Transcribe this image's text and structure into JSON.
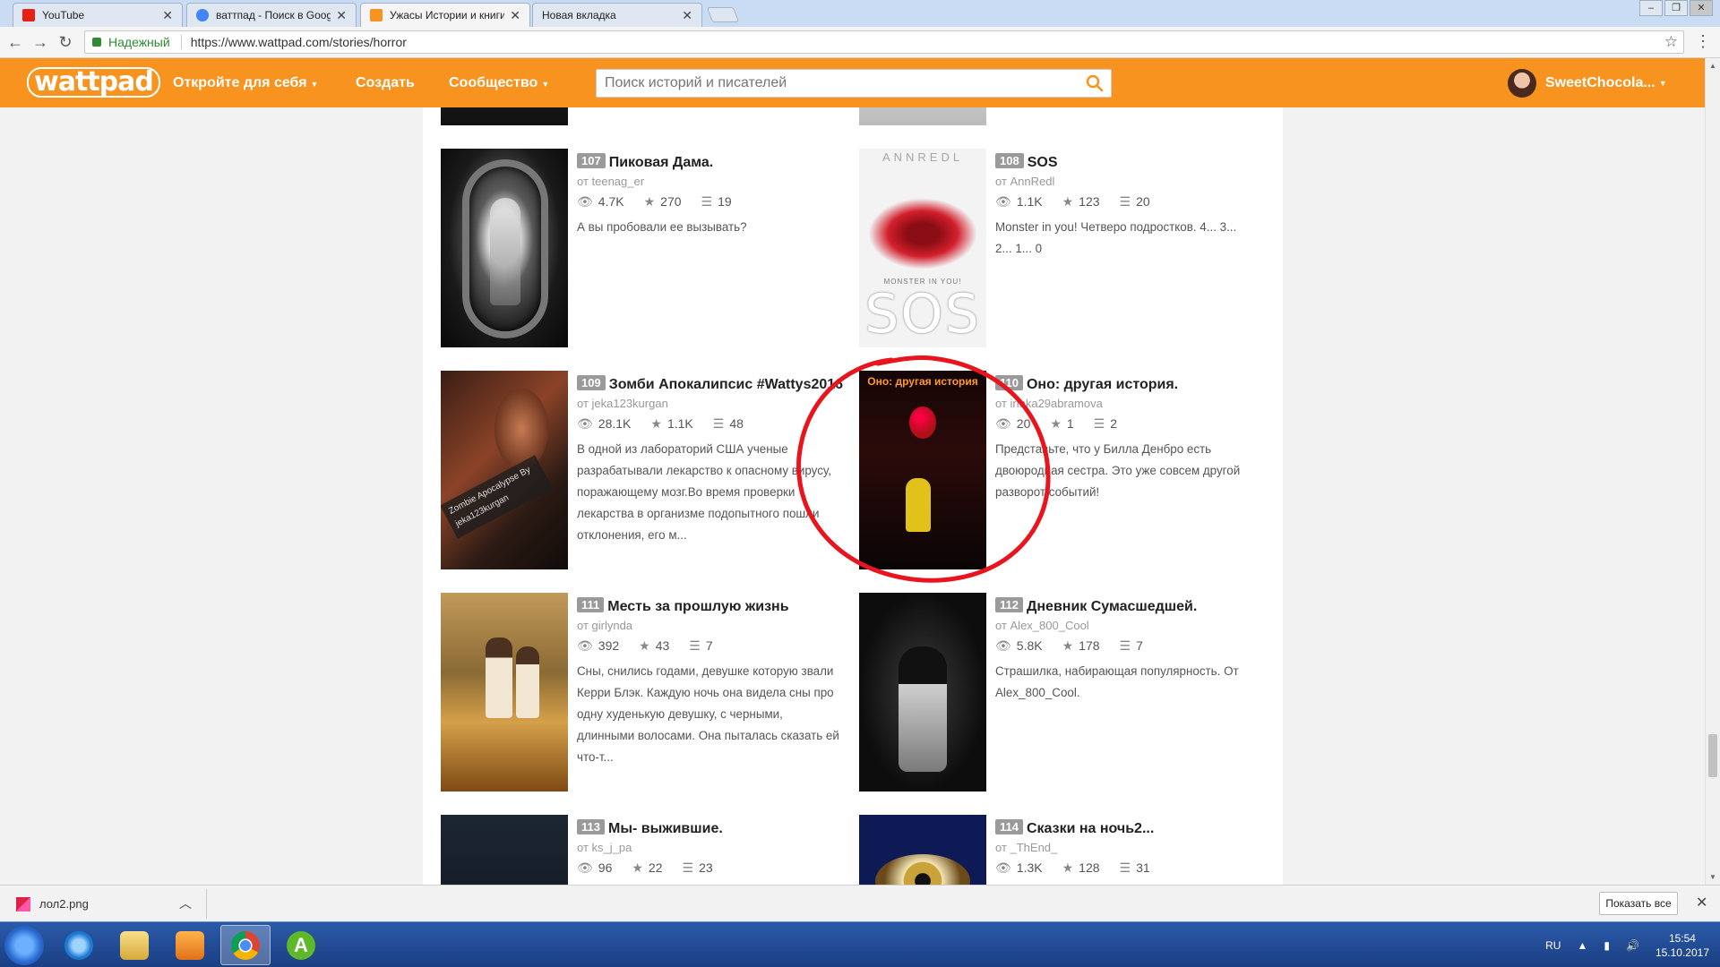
{
  "browser": {
    "tabs": [
      {
        "title": "YouTube",
        "favicon_color": "#e62117",
        "active": false
      },
      {
        "title": "ваттпад - Поиск в Google",
        "favicon_color": "#4285f4",
        "active": false
      },
      {
        "title": "Ужасы Истории и книги б",
        "favicon_color": "#f7931e",
        "active": true
      },
      {
        "title": "Новая вкладка",
        "favicon_color": "",
        "active": false
      }
    ],
    "secure_label": "Надежный",
    "url": "https://www.wattpad.com/stories/horror"
  },
  "header": {
    "logo": "wattpad",
    "nav_discover": "Откройте для себя",
    "nav_create": "Создать",
    "nav_community": "Сообщество",
    "search_placeholder": "Поиск историй и писателей",
    "username": "SweetChocola...",
    "brand_color": "#f7931e"
  },
  "stories": [
    {
      "rank": "107",
      "title": "Пиковая Дама.",
      "author": "от teenag_er",
      "reads": "4.7K",
      "votes": "270",
      "parts": "19",
      "desc": "А вы пробовали ее вызывать?"
    },
    {
      "rank": "108",
      "title": "SOS",
      "author": "от AnnRedl",
      "reads": "1.1K",
      "votes": "123",
      "parts": "20",
      "desc": "Monster in you! Четверо подростков. 4... 3... 2... 1... 0",
      "cover_text_top": "ANNREDL",
      "cover_text_small": "MONSTER IN YOU!",
      "cover_text_big": "SOS"
    },
    {
      "rank": "109",
      "title": "Зомби Апокалипсис #Wattys2016",
      "author": "от jeka123kurgan",
      "reads": "28.1K",
      "votes": "1.1K",
      "parts": "48",
      "desc": "В одной из лабораторий США ученые разрабатывали лекарство к опасному вирусу, поражающему мозг.Во время проверки лекарства в организме подопытного пошли отклонения, его м...",
      "cover_text": "Zombie Apocalypse By jeka123kurgan"
    },
    {
      "rank": "110",
      "title": "Оно: другая история.",
      "author": "от irinka29abramova",
      "reads": "20",
      "votes": "1",
      "parts": "2",
      "desc": "Представьте, что у Билла Денбро есть двоюродная сестра. Это уже совсем другой разворот событий!",
      "cover_text": "Оно: другая история"
    },
    {
      "rank": "111",
      "title": "Месть за прошлую жизнь",
      "author": "от girlynda",
      "reads": "392",
      "votes": "43",
      "parts": "7",
      "desc": "Сны, снились годами, девушке которую звали Керри Блэк. Каждую ночь она видела сны про одну худенькую девушку, с черными, длинными волосами. Она пыталась сказать ей что-т..."
    },
    {
      "rank": "112",
      "title": "Дневник Сумасшедшей.",
      "author": "от Alex_800_Cool",
      "reads": "5.8K",
      "votes": "178",
      "parts": "7",
      "desc": "Страшилка, набирающая популярность. От Alex_800_Cool."
    },
    {
      "rank": "113",
      "title": "Мы- выжившие.",
      "author": "от ks_j_pa",
      "reads": "96",
      "votes": "22",
      "parts": "23",
      "desc": ""
    },
    {
      "rank": "114",
      "title": "Сказки на ночь2...",
      "author": "от _ThEnd_",
      "reads": "1.3K",
      "votes": "128",
      "parts": "31",
      "desc": ""
    }
  ],
  "annotation_color": "#e8141e",
  "downloads": {
    "file": "лол2.png",
    "show_all": "Показать все"
  },
  "taskbar": {
    "lang": "RU",
    "time": "15:54",
    "date": "15.10.2017"
  }
}
